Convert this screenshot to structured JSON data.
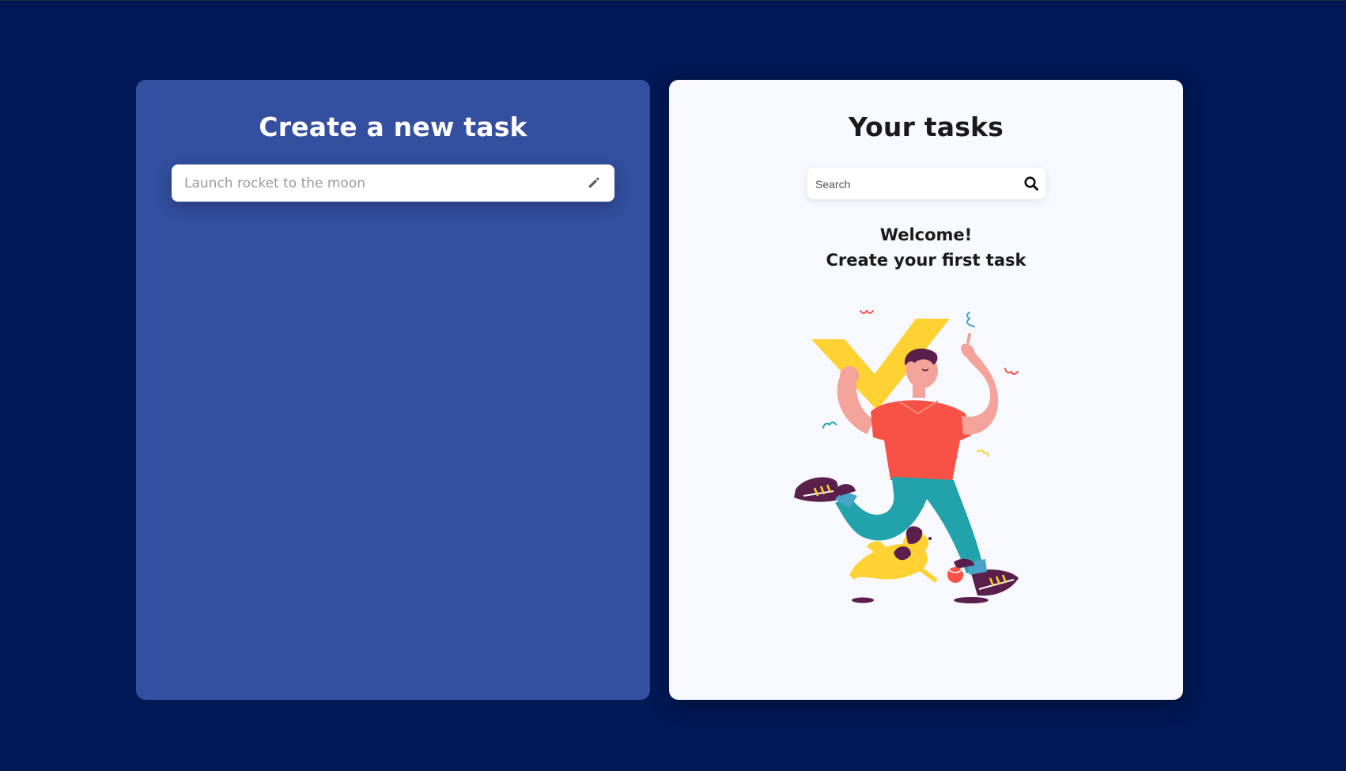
{
  "create_panel": {
    "title": "Create a new task",
    "task_input_placeholder": "Launch rocket to the moon",
    "task_input_value": "",
    "icon": "pencil-icon"
  },
  "tasks_panel": {
    "title": "Your tasks",
    "search_placeholder": "Search",
    "search_value": "",
    "search_icon": "search-icon",
    "welcome_line1": "Welcome!",
    "welcome_line2": "Create your first task",
    "illustration": "person-running-with-checkmark-and-dog"
  },
  "colors": {
    "background": "#001855",
    "left_panel": "#344f9f",
    "right_panel": "#f7f9fe",
    "checkmark": "#ffd233",
    "shirt": "#f85246",
    "pants": "#22a2aa"
  }
}
